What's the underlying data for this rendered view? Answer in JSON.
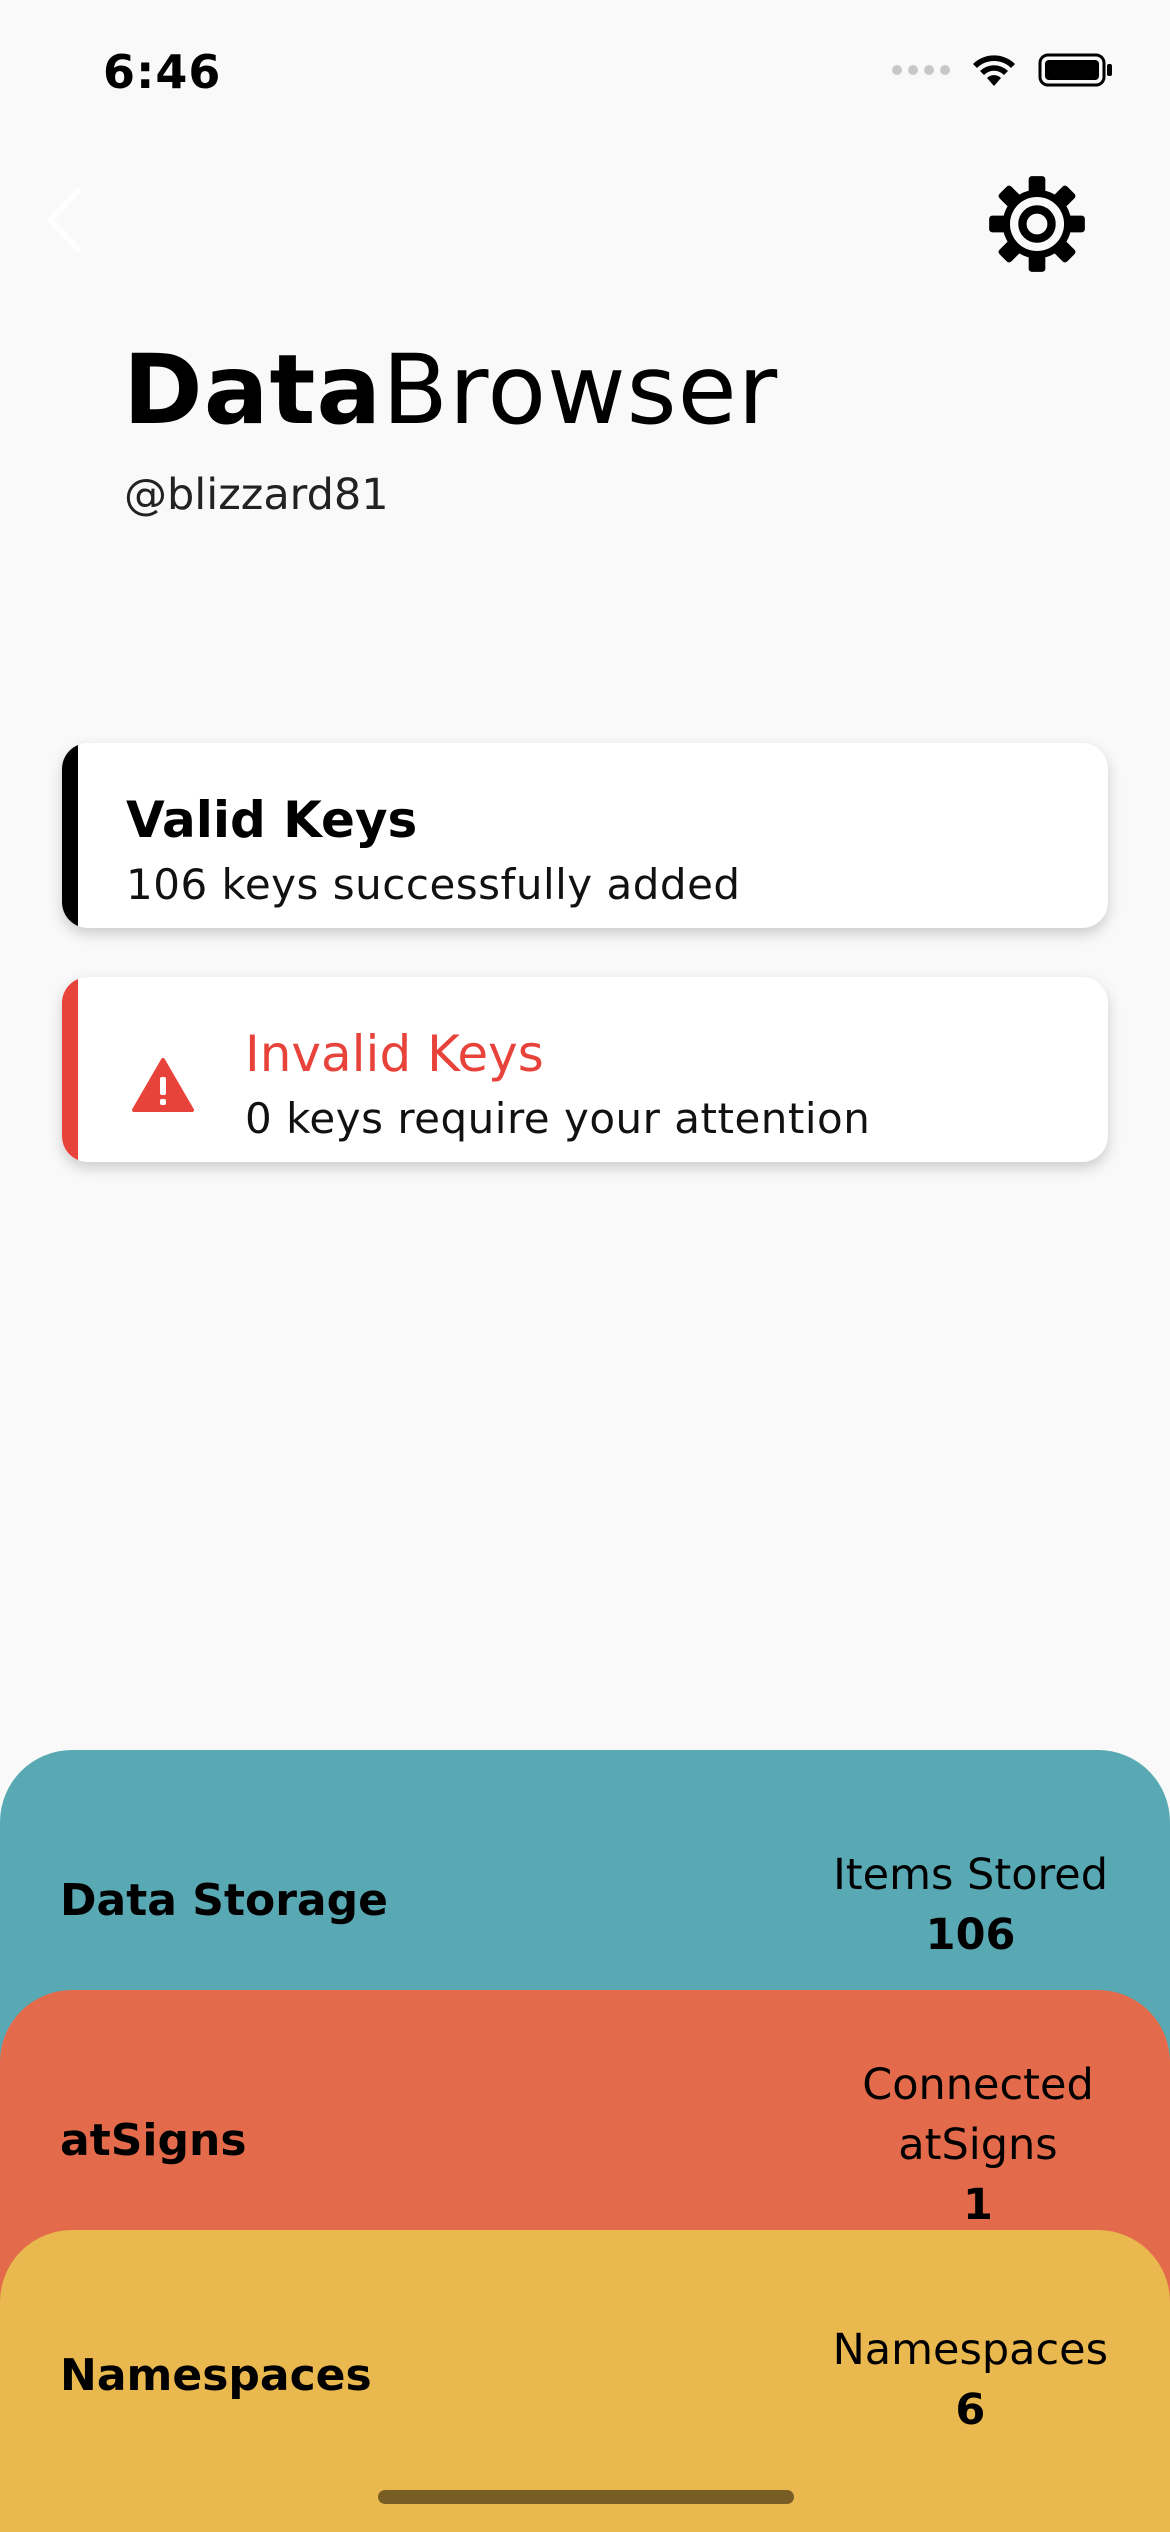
{
  "status_bar": {
    "time": "6:46",
    "icons": [
      "signal-icon",
      "wifi-icon",
      "battery-icon"
    ]
  },
  "nav": {
    "back_icon": "chevron-left-icon",
    "settings_icon": "gear-icon"
  },
  "header": {
    "title_bold": "Data",
    "title_light": "Browser",
    "handle": "@blizzard81"
  },
  "cards": {
    "valid": {
      "title": "Valid Keys",
      "subtitle": "106 keys successfully added",
      "accent_color": "#000000"
    },
    "invalid": {
      "title": "Invalid Keys",
      "subtitle": "0 keys require your attention",
      "accent_color": "#e8433a",
      "icon": "warning-icon"
    }
  },
  "panels": {
    "storage": {
      "label": "Data Storage",
      "stat_label": "Items Stored",
      "stat_value": "106",
      "color": "#58a9b4"
    },
    "atsigns": {
      "label": "atSigns",
      "stat_label": "Connected atSigns",
      "stat_value": "1",
      "color": "#e36a4a"
    },
    "namespaces": {
      "label": "Namespaces",
      "stat_label": "Namespaces",
      "stat_value": "6",
      "color": "#e9b84f"
    }
  }
}
